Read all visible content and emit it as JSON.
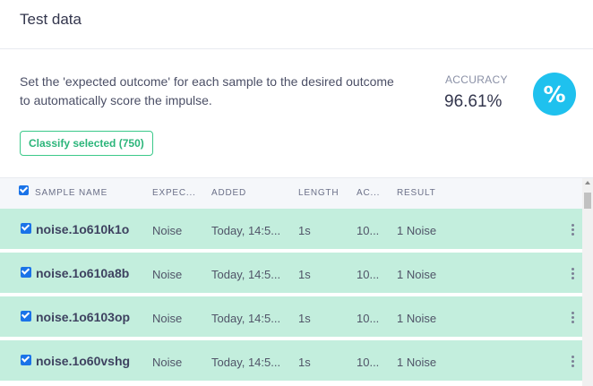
{
  "header": {
    "title": "Test data"
  },
  "description": {
    "line1": "Set the 'expected outcome' for each sample to the desired outcome",
    "line2": "to automatically score the impulse."
  },
  "accuracy": {
    "label": "ACCURACY",
    "value": "96.61%",
    "icon": "percent-icon",
    "icon_glyph": "%",
    "color": "#1fc1ee"
  },
  "classify_button": {
    "label": "Classify selected (750)",
    "color": "#3bc98a"
  },
  "table": {
    "columns": [
      "SAMPLE NAME",
      "EXPEC...",
      "ADDED",
      "LENGTH",
      "AC...",
      "RESULT"
    ],
    "rows": [
      {
        "name": "noise.1o610k1o",
        "expected": "Noise",
        "added": "Today, 14:5...",
        "length": "1s",
        "accuracy": "10...",
        "result": "1 Noise"
      },
      {
        "name": "noise.1o610a8b",
        "expected": "Noise",
        "added": "Today, 14:5...",
        "length": "1s",
        "accuracy": "10...",
        "result": "1 Noise"
      },
      {
        "name": "noise.1o6103op",
        "expected": "Noise",
        "added": "Today, 14:5...",
        "length": "1s",
        "accuracy": "10...",
        "result": "1 Noise"
      },
      {
        "name": "noise.1o60vshg",
        "expected": "Noise",
        "added": "Today, 14:5...",
        "length": "1s",
        "accuracy": "10...",
        "result": "1 Noise"
      }
    ],
    "row_highlight_color": "#c3eedd"
  }
}
